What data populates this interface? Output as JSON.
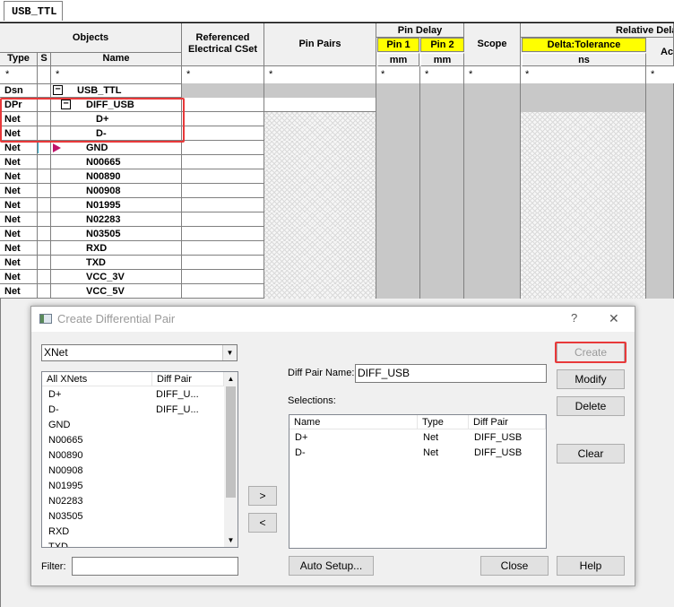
{
  "tab": {
    "label": "USB_TTL"
  },
  "header": {
    "objects": "Objects",
    "type": "Type",
    "s": "S",
    "name": "Name",
    "ref_cset": "Referenced Electrical CSet",
    "pin_pairs": "Pin Pairs",
    "pin_delay": "Pin Delay",
    "pin1": "Pin 1",
    "pin2": "Pin 2",
    "unit_mm": "mm",
    "scope": "Scope",
    "relative_delay": "Relative Delay",
    "delta_tol": "Delta:Tolerance",
    "unit_ns": "ns",
    "actual": "Act",
    "filter": "*"
  },
  "rows": [
    {
      "type": "Dsn",
      "name": "USB_TTL"
    },
    {
      "type": "DPr",
      "name": "DIFF_USB"
    },
    {
      "type": "Net",
      "name": "D+"
    },
    {
      "type": "Net",
      "name": "D-"
    },
    {
      "type": "Net",
      "name": "GND"
    },
    {
      "type": "Net",
      "name": "N00665"
    },
    {
      "type": "Net",
      "name": "N00890"
    },
    {
      "type": "Net",
      "name": "N00908"
    },
    {
      "type": "Net",
      "name": "N01995"
    },
    {
      "type": "Net",
      "name": "N02283"
    },
    {
      "type": "Net",
      "name": "N03505"
    },
    {
      "type": "Net",
      "name": "RXD"
    },
    {
      "type": "Net",
      "name": "TXD"
    },
    {
      "type": "Net",
      "name": "VCC_3V"
    },
    {
      "type": "Net",
      "name": "VCC_5V"
    }
  ],
  "dialog": {
    "title": "Create Differential Pair",
    "help_glyph": "?",
    "close_glyph": "✕",
    "filter_type": "XNet",
    "left_list": {
      "col1": "All XNets",
      "col2": "Diff Pair",
      "items": [
        {
          "name": "D+",
          "pair": "DIFF_U..."
        },
        {
          "name": "D-",
          "pair": "DIFF_U..."
        },
        {
          "name": "GND",
          "pair": ""
        },
        {
          "name": "N00665",
          "pair": ""
        },
        {
          "name": "N00890",
          "pair": ""
        },
        {
          "name": "N00908",
          "pair": ""
        },
        {
          "name": "N01995",
          "pair": ""
        },
        {
          "name": "N02283",
          "pair": ""
        },
        {
          "name": "N03505",
          "pair": ""
        },
        {
          "name": "RXD",
          "pair": ""
        },
        {
          "name": "TXD",
          "pair": ""
        }
      ]
    },
    "add_btn": ">",
    "remove_btn": "<",
    "diff_pair_name_label": "Diff Pair Name:",
    "diff_pair_name_value": "DIFF_USB",
    "selections_label": "Selections:",
    "sel_list": {
      "col1": "Name",
      "col2": "Type",
      "col3": "Diff Pair",
      "items": [
        {
          "name": "D+",
          "type": "Net",
          "pair": "DIFF_USB"
        },
        {
          "name": "D-",
          "type": "Net",
          "pair": "DIFF_USB"
        }
      ]
    },
    "buttons": {
      "create": "Create",
      "modify": "Modify",
      "delete": "Delete",
      "clear": "Clear",
      "auto_setup": "Auto Setup...",
      "close": "Close",
      "help": "Help"
    },
    "filter_label": "Filter:",
    "filter_value": ""
  },
  "colors": {
    "highlight_red": "#e8393a",
    "yellow_header": "#ffff00"
  }
}
